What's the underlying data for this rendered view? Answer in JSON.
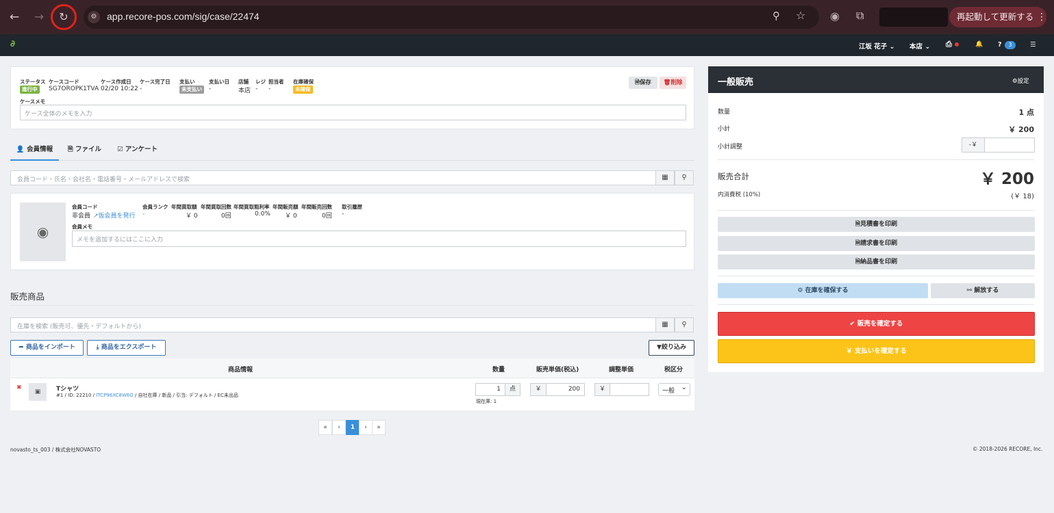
{
  "browser": {
    "url": "app.recore-pos.com/sig/case/22474",
    "restart_label": "再起動して更新する",
    "back_glyph": "←",
    "forward_glyph": "→",
    "reload_glyph": "↻",
    "zoom_glyph": "⚲",
    "star_glyph": "☆",
    "camera_glyph": "◉",
    "ext_glyph": "⧉",
    "menu_glyph": "⋮",
    "site_glyph": "⚙"
  },
  "appnav": {
    "logo": "∂",
    "user": "江坂 花子",
    "store": "本店",
    "help_count": "3",
    "user_caret": "⌄",
    "store_caret": "⌄",
    "printer_glyph": "⎙",
    "bell_glyph": "🔔",
    "help_glyph": "?",
    "grid_glyph": "☰"
  },
  "case": {
    "labels": {
      "status": "ステータス",
      "code": "ケースコード",
      "created": "ケース作成日",
      "completed": "ケース完了日",
      "payment": "支払い",
      "pay_date": "支払い日",
      "store": "店舗",
      "register": "レジ",
      "staff": "担当者",
      "stock": "在庫確保",
      "memo": "ケースメモ"
    },
    "status_badge": "進行中",
    "code": "SG7OROPK1TVA",
    "created": "02/20 10:22",
    "completed": "-",
    "payment_badge": "未支払い",
    "pay_date": "-",
    "store": "本店",
    "register": "-",
    "staff": "-",
    "stock_badge": "未確保",
    "memo_placeholder": "ケース全体のメモを入力",
    "save_label": "保存",
    "delete_label": "削除",
    "save_glyph": "🗎",
    "delete_glyph": "🗑",
    "colors": {
      "status": "#7cb342",
      "payment": "#9e9e9e",
      "stock": "#f7b924"
    }
  },
  "tabs": [
    {
      "label": "会員情報",
      "glyph": "👤"
    },
    {
      "label": "ファイル",
      "glyph": "🗎"
    },
    {
      "label": "アンケート",
      "glyph": "☑"
    }
  ],
  "member": {
    "search_placeholder": "会員コード・氏名・会社名・電話番号・メールアドレスで検索",
    "labels": {
      "code": "会員コード",
      "rank": "会員ランク",
      "buy_amount": "年間買取額",
      "buy_count": "年間買取回数",
      "buy_margin": "年間買取粗利率",
      "sell_amount": "年間販売額",
      "sell_count": "年間販売回数",
      "history": "取引履歴",
      "memo": "会員メモ"
    },
    "code": "非会員",
    "issue_link": "仮会員を発行",
    "rank": "-",
    "buy_amount": "￥ 0",
    "buy_count": "0回",
    "buy_margin": "0.0%",
    "sell_amount": "￥ 0",
    "sell_count": "0回",
    "history": "-",
    "memo_placeholder": "メモを追加するにはここに入力",
    "avatar_glyph": "◉",
    "link_glyph": "↗"
  },
  "products": {
    "heading": "販売商品",
    "search_placeholder": "在庫を検索 (販売可、優先・デフォルトから)",
    "import_label": "商品をインポート",
    "export_label": "商品をエクスポート",
    "filter_label": "絞り込み",
    "import_glyph": "➦",
    "export_glyph": "⤓",
    "filter_glyph": "▼",
    "headers": {
      "info": "商品情報",
      "qty": "数量",
      "price": "販売単価(税込)",
      "adjust": "調整単価",
      "tax": "税区分"
    },
    "rows": [
      {
        "name": "Tシャツ",
        "meta_prefix": "#1 / ID: 22210 / ",
        "meta_link": "ITCP96XC8W6O",
        "meta_suffix": " / 自社在庫 / 新品 / 引当: デフォルト / EC未出品",
        "qty": "1",
        "qty_unit": "点",
        "stock": "現在庫: 1",
        "currency": "￥",
        "price": "200",
        "adjust": "",
        "tax": "一般",
        "remove_glyph": "✖",
        "image_glyph": "▣",
        "select_caret": "⌄"
      }
    ]
  },
  "pagination": {
    "first": "«",
    "prev": "‹",
    "current": "1",
    "next": "›",
    "last": "»"
  },
  "footer": {
    "left": "novasto_ts_003 / 株式会社NOVASTO",
    "right": "© 2018-2026 RECORE, Inc."
  },
  "sidebar": {
    "title": "一般販売",
    "settings_label": "設定",
    "settings_glyph": "⚙",
    "qty_label": "数量",
    "qty_value": "1 点",
    "subtotal_label": "小計",
    "subtotal_value": "￥ 200",
    "adjust_label": "小計調整",
    "adjust_prefix": "-￥",
    "adjust_value": "",
    "total_label": "販売合計",
    "total_value": "￥ 200",
    "tax_label": "内消費税 (10%)",
    "tax_value": "(￥ 18)",
    "print_estimate": "見積書を印刷",
    "print_invoice": "請求書を印刷",
    "print_delivery": "納品書を印刷",
    "print_glyph": "🗎",
    "reserve_label": "在庫を確保する",
    "release_label": "解放する",
    "reserve_glyph": "⚙",
    "release_glyph": "⚯",
    "confirm_sale_label": "販売を確定する",
    "confirm_sale_glyph": "✔",
    "confirm_payment_label": "￥ 支払いを確定する",
    "colors": {
      "header": "#2b3036",
      "confirm_sale": "#ee4444",
      "confirm_payment": "#fcc419",
      "reserve": "#c1ddf3"
    }
  }
}
